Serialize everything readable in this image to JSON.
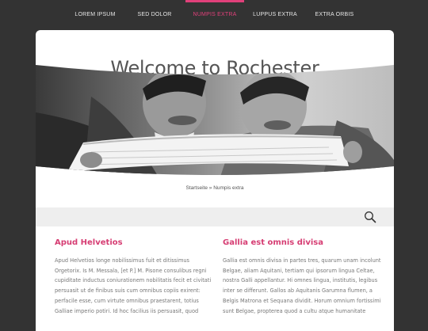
{
  "nav": {
    "items": [
      {
        "label": "LOREM IPSUM"
      },
      {
        "label": "SED DOLOR"
      },
      {
        "label": "NUMPIS EXTRA",
        "active": true
      },
      {
        "label": "LUPPUS EXTRA"
      },
      {
        "label": "EXTRA ORBIS"
      }
    ]
  },
  "hero": {
    "title": "Welcome to Rochester"
  },
  "breadcrumb": {
    "home": "Startseite",
    "separator": "»",
    "current": "Numpis extra"
  },
  "search": {
    "icon": "search-icon"
  },
  "columns": [
    {
      "heading": "Apud Helvetios",
      "body": "Apud Helvetios longe nobilissimus fuit et ditissimus Orgetorix. Is M. Messala, [et P.] M. Pisone consulibus regni cupiditate inductus coniurationem nobilitatis fecit et civitati persuasit ut de finibus suis cum omnibus copiis exirent: perfacile esse, cum virtute omnibus praestarent, totius Galliae imperio potiri. Id hoc facilius iis persuasit, quod"
    },
    {
      "heading": "Gallia est omnis divisa",
      "body": "Gallia est omnis divisa in partes tres, quarum unam incolunt Belgae, aliam Aquitani, tertiam qui ipsorum lingua Celtae, nostra Galli appellantur. Hi omnes lingua, institutis, legibus inter se differunt. Gallos ab Aquitanis Garumna flumen, a Belgis Matrona et Sequana dividit. Horum omnium fortissimi sunt Belgae, propterea quod a cultu atque humanitate"
    }
  ],
  "colors": {
    "accent": "#e0407a",
    "heading": "#d63d73",
    "background": "#333333"
  }
}
